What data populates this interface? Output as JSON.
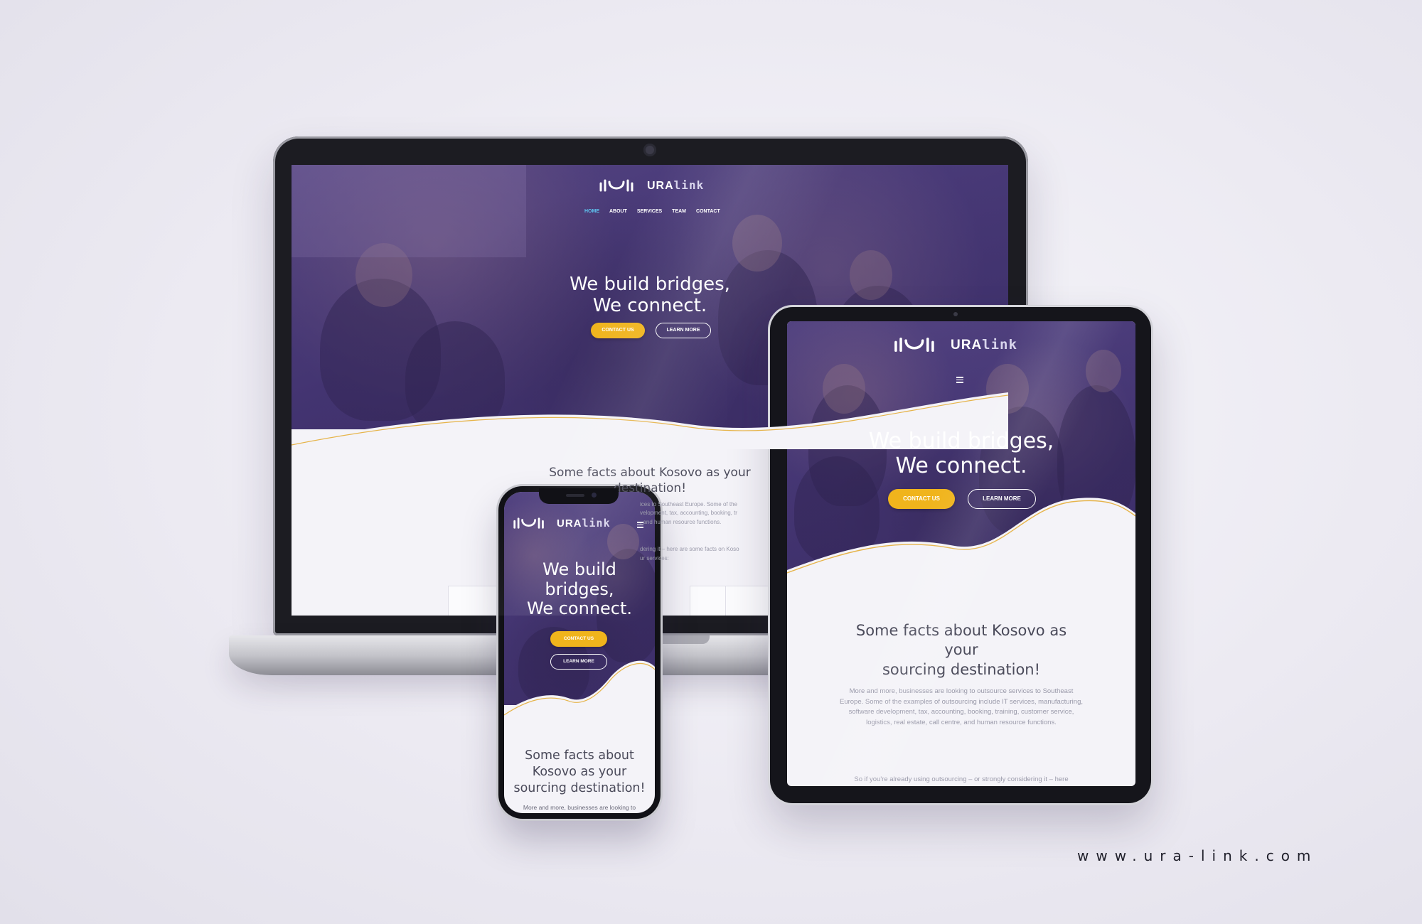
{
  "brand": {
    "logo_prefix": "URA",
    "logo_suffix": "link"
  },
  "nav": {
    "items": [
      "HOME",
      "ABOUT",
      "SERVICES",
      "TEAM",
      "CONTACT"
    ],
    "active": "HOME"
  },
  "hero": {
    "title_line1": "We build bridges,",
    "title_line2": "We connect.",
    "phone_line1": "We build",
    "phone_line2": "bridges,",
    "phone_line3": "We connect.",
    "contact_button": "CONTACT US",
    "learn_button": "LEARN MORE"
  },
  "facts": {
    "laptop_line1": "Some facts about Kosovo as your",
    "laptop_line2": "destination!",
    "tablet_line1": "Some facts about Kosovo as",
    "tablet_line2": "your",
    "tablet_line3": "sourcing destination!",
    "phone_line1": "Some facts about",
    "phone_line2": "Kosovo as your",
    "phone_line3": "sourcing destination!",
    "laptop_body_1": "ices to Southeast Europe. Some of the",
    "laptop_body_2": "velopment, tax, accounting, booking, tr",
    "laptop_body_3": ", and human resource functions.",
    "laptop_body_4": "dering it – here are some facts on Koso",
    "laptop_body_5": "ur services:",
    "tablet_body": "More and more, businesses are looking to outsource services to Southeast Europe. Some of the examples of outsourcing include IT services, manufacturing, software development, tax, accounting, booking, training, customer service, logistics, real estate, call centre, and human resource functions.",
    "tablet_body_2": "So if you're already using outsourcing – or strongly considering it – here",
    "phone_body": "More and more, businesses are looking to"
  },
  "footer": {
    "url": "www.ura-link.com"
  },
  "colors": {
    "accent_yellow": "#f0b41c",
    "hero_purple": "#4a3b78",
    "nav_active": "#5ec4f0"
  }
}
